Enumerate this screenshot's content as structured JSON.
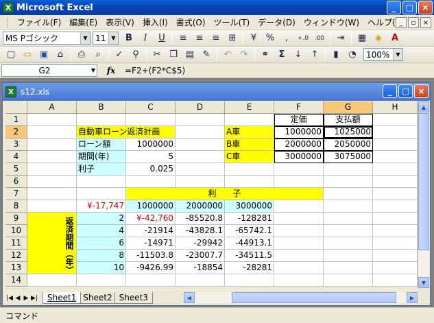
{
  "window": {
    "title": "Microsoft Excel",
    "app_icon": "X",
    "min": "_",
    "max": "□",
    "close": "×"
  },
  "menu": [
    "ファイル(F)",
    "編集(E)",
    "表示(V)",
    "挿入(I)",
    "書式(O)",
    "ツール(T)",
    "データ(D)",
    "ウィンドウ(W)",
    "ヘルプ(H)"
  ],
  "format_toolbar": {
    "font": "MS Pゴシック",
    "size": "11",
    "bold": "B",
    "italic": "I",
    "underline": "U",
    "percent": "%",
    "comma": ",",
    "inc_decimal": "+.0",
    "dec_decimal": ".00"
  },
  "standard_toolbar": {
    "zoom": "100%",
    "sigma": "Σ"
  },
  "formula_bar": {
    "name_box": "G2",
    "fx": "fx",
    "formula": "=F2+(F2*C$5)"
  },
  "workbook": {
    "title": "s12.xls",
    "icon": "X"
  },
  "columns": [
    "A",
    "B",
    "C",
    "D",
    "E",
    "F",
    "G",
    "H"
  ],
  "rows": [
    "1",
    "2",
    "3",
    "4",
    "5",
    "6",
    "7",
    "8",
    "9",
    "10",
    "11",
    "12",
    "13",
    "14"
  ],
  "cells": {
    "F1": "定価",
    "G1": "支払額",
    "B2": "自動車ローン返済計画",
    "E2": "A車",
    "F2": "1000000",
    "G2": "1025000",
    "B3": "ローン額",
    "C3": "1000000",
    "E3": "B車",
    "F3": "2000000",
    "G3": "2050000",
    "B4": "期間(年)",
    "C4": "5",
    "E4": "C車",
    "F4": "3000000",
    "G4": "3075000",
    "B5": "利子",
    "C5": "0.025",
    "C7": "利　　子",
    "B8": "¥-17,747",
    "C8": "1000000",
    "D8": "2000000",
    "E8": "3000000",
    "A9": "返済期間（年）",
    "B9": "2",
    "C9": "¥-42,760",
    "D9": "-85520.8",
    "E9": "-128281",
    "B10": "4",
    "C10": "-21914",
    "D10": "-43828.1",
    "E10": "-65742.1",
    "B11": "6",
    "C11": "-14971",
    "D11": "-29942",
    "E11": "-44913.1",
    "B12": "8",
    "C12": "-11503.8",
    "D12": "-23007.7",
    "E12": "-34511.5",
    "B13": "10",
    "C13": "-9426.99",
    "D13": "-18854",
    "E13": "-28281"
  },
  "sheet_tabs": [
    "Sheet1",
    "Sheet2",
    "Sheet3"
  ],
  "active_sheet": "Sheet1",
  "status": "コマンド"
}
